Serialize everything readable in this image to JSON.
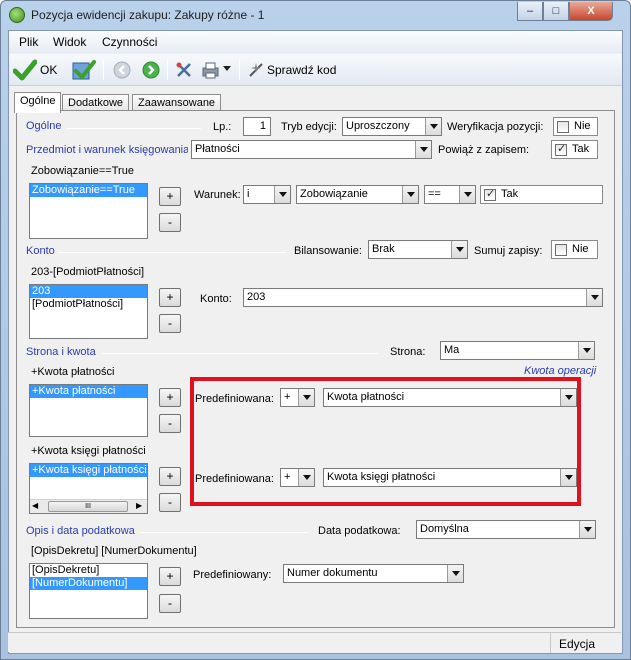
{
  "window": {
    "title": "Pozycja ewidencji zakupu: Zakupy różne - 1",
    "min_label": "–",
    "max_label": "□",
    "close_label": "X"
  },
  "menu": [
    {
      "label": "Plik",
      "underline": "P"
    },
    {
      "label": "Widok",
      "underline": "W"
    },
    {
      "label": "Czynności",
      "underline": "C"
    }
  ],
  "toolbar": {
    "ok_label": "OK",
    "check_label": "Sprawdź kod",
    "icons": [
      "ok-check-icon",
      "save-check-icon",
      "back-arrow-icon",
      "forward-arrow-icon",
      "tools-icon",
      "print-icon",
      "check-code-icon"
    ]
  },
  "tabs": [
    "Ogólne",
    "Dodatkowe",
    "Zaawansowane"
  ],
  "general": {
    "section": "Ogólne",
    "lp_label": "Lp.:",
    "lp_value": "1",
    "tryb_label": "Tryb edycji:",
    "tryb_value": "Uproszczony",
    "weryf_label": "Weryfikacja pozycji:",
    "weryf_value": "Nie",
    "predmiot_label": "Przedmiot i warunek księgowania:",
    "predmiot_value": "Płatności",
    "powiaz_label": "Powiąż z zapisem:",
    "powiaz_value": "Tak",
    "condition_text": "Zobowiązanie==True",
    "condition_list": [
      "Zobowiązanie==True"
    ],
    "warunek_label": "Warunek:",
    "warunek_op": "i",
    "warunek_field": "Zobowiązanie",
    "warunek_cmp": "==",
    "warunek_value": "Tak"
  },
  "konto": {
    "section": "Konto",
    "bilans_label": "Bilansowanie:",
    "bilans_value": "Brak",
    "sumuj_label": "Sumuj zapisy:",
    "sumuj_value": "Nie",
    "text": "203-[PodmiotPłatności]",
    "list": [
      "203",
      "[PodmiotPłatności]"
    ],
    "konto_label": "Konto:",
    "konto_value": "203"
  },
  "strona": {
    "section": "Strona i kwota",
    "strona_label": "Strona:",
    "strona_value": "Ma",
    "kwota_op_note": "Kwota operacji",
    "kwota_platnosci_text": "+Kwota płatności",
    "kwota_platnosci_list": [
      "+Kwota płatności"
    ],
    "predef_label": "Predefiniowana:",
    "predef_sign1": "+",
    "predef_value1": "Kwota płatności",
    "kwota_ksiegi_text": "+Kwota księgi płatności",
    "kwota_ksiegi_list": [
      "+Kwota księgi płatności"
    ],
    "predef_sign2": "+",
    "predef_value2": "Kwota księgi płatności",
    "scroll_grip": "III"
  },
  "opis": {
    "section": "Opis i data podatkowa",
    "data_label": "Data podatkowa:",
    "data_value": "Domyślna",
    "text": "[OpisDekretu] [NumerDokumentu]",
    "list": [
      "[OpisDekretu]",
      "[NumerDokumentu]"
    ],
    "predef_label": "Predefiniowany:",
    "predef_value": "Numer dokumentu"
  },
  "buttons": {
    "plus": "+",
    "minus": "-"
  },
  "status": {
    "mode": "Edycja"
  },
  "colors": {
    "section_text": "#2a3cad",
    "selection": "#3399ff",
    "highlight_box": "#e0101d"
  }
}
